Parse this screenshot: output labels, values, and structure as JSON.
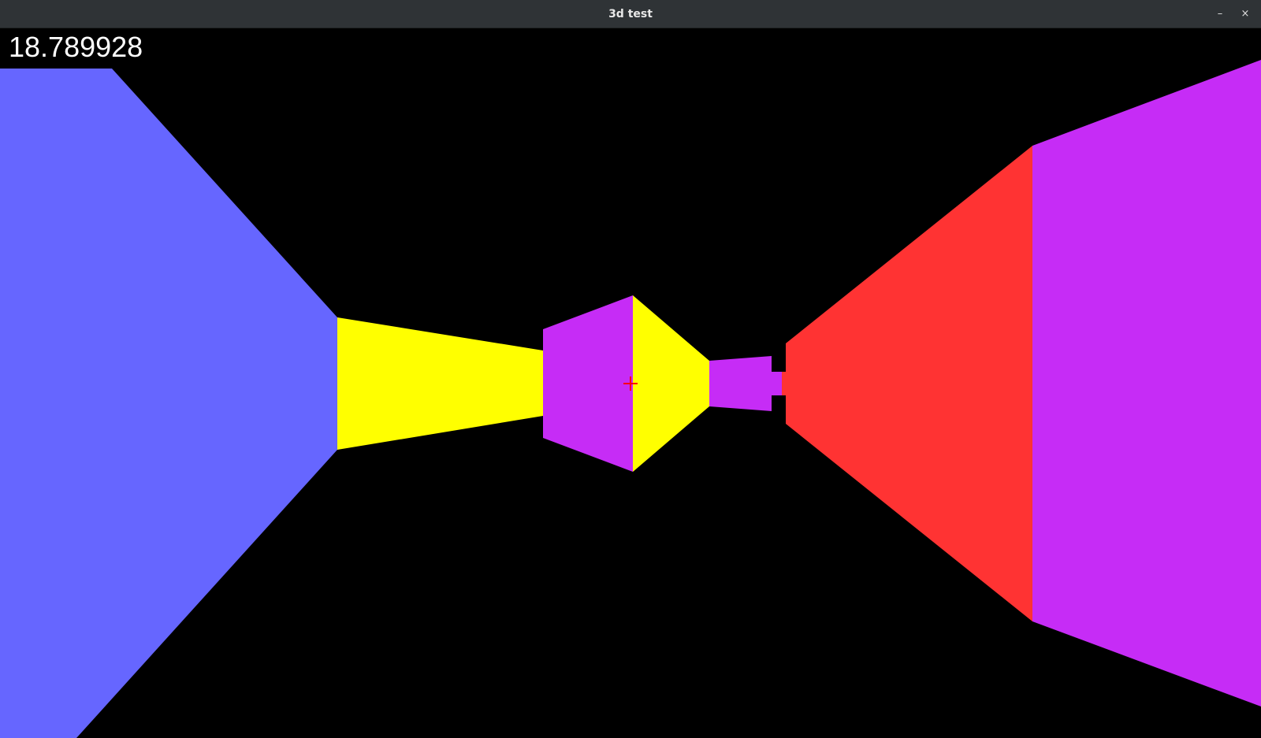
{
  "window": {
    "title": "3d test",
    "minimize_label": "–",
    "close_label": "×"
  },
  "hud": {
    "value_text": "18.789928"
  },
  "scene": {
    "background": "#000000",
    "colors": {
      "blue": "#6666ff",
      "yellow": "#ffff00",
      "purple": "#c62cf6",
      "red": "#ff3333",
      "crosshair": "#ff0000"
    }
  }
}
